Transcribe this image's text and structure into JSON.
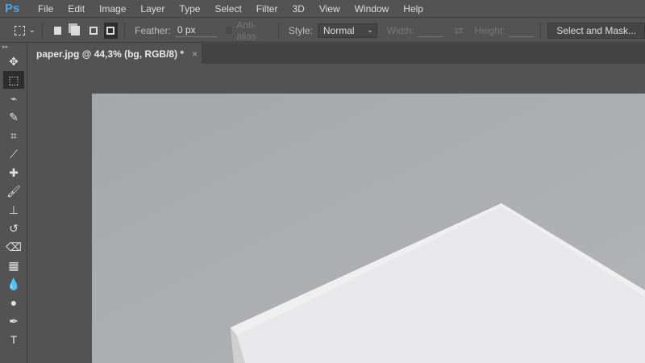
{
  "app": {
    "logo": "Ps"
  },
  "menu": [
    "File",
    "Edit",
    "Image",
    "Layer",
    "Type",
    "Select",
    "Filter",
    "3D",
    "View",
    "Window",
    "Help"
  ],
  "options": {
    "feather_label": "Feather:",
    "feather_value": "0 px",
    "antialias_label": "Anti-alias",
    "style_label": "Style:",
    "style_value": "Normal",
    "width_label": "Width:",
    "height_label": "Height:",
    "select_mask_label": "Select and Mask..."
  },
  "document": {
    "tab_title": "paper.jpg @ 44,3% (bg, RGB/8) *",
    "close": "×"
  },
  "tools": [
    {
      "name": "move-tool",
      "glyph": "✥"
    },
    {
      "name": "marquee-tool",
      "glyph": "⬚"
    },
    {
      "name": "lasso-tool",
      "glyph": "⌁"
    },
    {
      "name": "quick-select-tool",
      "glyph": "✎"
    },
    {
      "name": "crop-tool",
      "glyph": "⌗"
    },
    {
      "name": "eyedropper-tool",
      "glyph": "⟋"
    },
    {
      "name": "healing-brush-tool",
      "glyph": "✚"
    },
    {
      "name": "brush-tool",
      "glyph": "🖌"
    },
    {
      "name": "clone-stamp-tool",
      "glyph": "⊥"
    },
    {
      "name": "history-brush-tool",
      "glyph": "↺"
    },
    {
      "name": "eraser-tool",
      "glyph": "⌫"
    },
    {
      "name": "gradient-tool",
      "glyph": "▦"
    },
    {
      "name": "blur-tool",
      "glyph": "💧"
    },
    {
      "name": "dodge-tool",
      "glyph": "●"
    },
    {
      "name": "pen-tool",
      "glyph": "✒"
    },
    {
      "name": "type-tool",
      "glyph": "T"
    }
  ]
}
